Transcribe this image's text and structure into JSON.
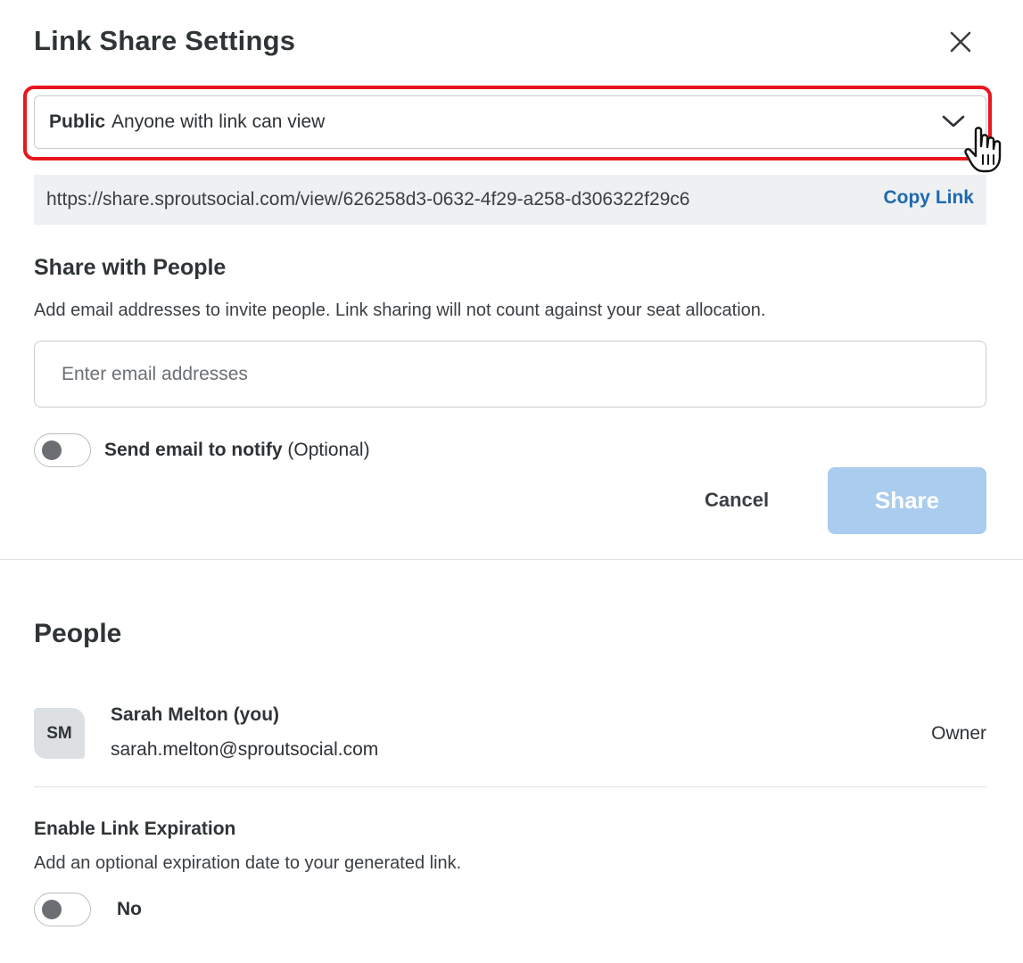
{
  "dialog": {
    "title": "Link Share Settings",
    "close_icon": "close-icon"
  },
  "visibility": {
    "level": "Public",
    "description": "Anyone with link can view",
    "chevron_icon": "chevron-down-icon"
  },
  "link": {
    "url": "https://share.sproutsocial.com/view/626258d3-0632-4f29-a258-d306322f29c6",
    "copy_label": "Copy Link",
    "copy_color": "#2069b0"
  },
  "share_with_people": {
    "title": "Share with People",
    "description": "Add email addresses to invite people. Link sharing will not count against your seat allocation.",
    "email_placeholder": "Enter email addresses",
    "email_value": "",
    "notify_label": "Send email to notify",
    "notify_optional": "(Optional)",
    "notify_enabled": false,
    "cancel_label": "Cancel",
    "share_label": "Share",
    "share_color": "#a9ccef"
  },
  "people": {
    "title": "People",
    "items": [
      {
        "initials": "SM",
        "name": "Sarah Melton (you)",
        "email": "sarah.melton@sproutsocial.com",
        "role": "Owner"
      }
    ]
  },
  "expiration": {
    "title": "Enable Link Expiration",
    "description": "Add an optional expiration date to your generated link.",
    "enabled": false,
    "state_label": "No"
  },
  "highlight_color": "#e8161d"
}
